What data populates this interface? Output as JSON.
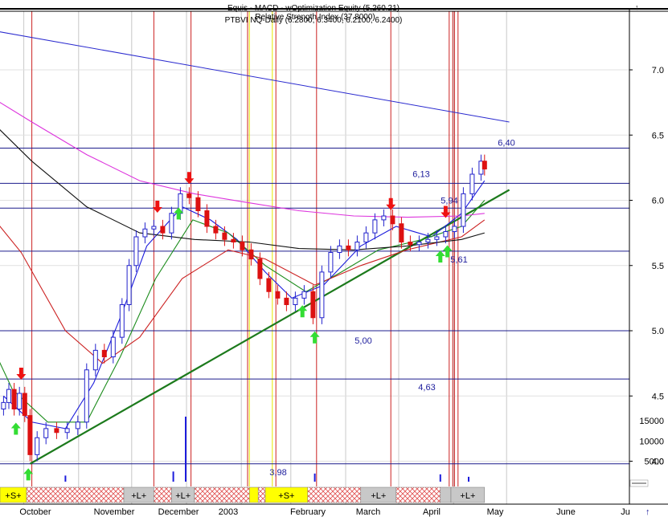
{
  "chart_data": {
    "type": "line",
    "subtype": "candlestick-price-chart",
    "header_lines": [
      "Equis - MACD - wOptimization Equity (5,260.21)",
      "Relative Strength Index (37.8000)",
      "PTBVI NQ-Daily (6.2800, 6.3400, 6.2100, 6.2400)"
    ],
    "x_ticks": [
      "October",
      "November",
      "December",
      "2003",
      "February",
      "March",
      "April",
      "May",
      "June",
      "Ju"
    ],
    "price_axis": {
      "ylim": [
        3.8,
        7.4
      ],
      "ticks": [
        "7.0",
        "6.5",
        "6.0",
        "5.5",
        "5.0",
        "4.5",
        "4.0"
      ]
    },
    "volume_axis": {
      "ylim": [
        0,
        17000
      ],
      "ticks": [
        "15000",
        "10000",
        "5000"
      ]
    },
    "horizontal_levels": [
      "6,40",
      "6,13",
      "5,94",
      "5,61",
      "5,00",
      "4,63",
      "3,98"
    ],
    "trend_lines": [
      {
        "name": "support",
        "color": "#1c7a1c",
        "from": {
          "date": "2002-09-30",
          "price": 3.98
        },
        "to": {
          "date": "2003-06-28",
          "price": 6.08
        }
      },
      {
        "name": "resistance",
        "color": "#2a2acf",
        "from": {
          "date": "2002-09-01",
          "price": 7.32
        },
        "to": {
          "date": "2003-06-28",
          "price": 6.6
        }
      }
    ],
    "buy_signals": [
      "2002-09-22",
      "2002-09-29",
      "2002-12-23",
      "2003-03-03",
      "2003-03-10",
      "2003-05-20",
      "2003-05-24"
    ],
    "sell_signals": [
      "2002-09-25",
      "2002-12-11",
      "2002-12-29",
      "2003-04-22",
      "2003-05-23"
    ],
    "signal_lines": [
      {
        "date": "2002-10-01",
        "color": "#cc2222"
      },
      {
        "date": "2002-12-09",
        "color": "#cc2222"
      },
      {
        "date": "2002-12-30",
        "color": "#cc2222"
      },
      {
        "date": "2003-01-31",
        "color": "#cc2222"
      },
      {
        "date": "2003-02-01",
        "color": "#e6e600"
      },
      {
        "date": "2003-02-14",
        "color": "#e6e600"
      },
      {
        "date": "2003-02-16",
        "color": "#cc2222"
      },
      {
        "date": "2003-03-11",
        "color": "#cc2222"
      },
      {
        "date": "2003-04-22",
        "color": "#cc2222"
      },
      {
        "date": "2003-05-25",
        "color": "#cc2222"
      },
      {
        "date": "2003-05-27",
        "color": "#cc2222"
      },
      {
        "date": "2003-05-28",
        "color": "#cc2222"
      },
      {
        "date": "2003-05-30",
        "color": "#cc2222"
      }
    ],
    "position_bands": [
      {
        "label": "+S+",
        "type": "short",
        "start": "2002-09-13",
        "end": "2002-09-28"
      },
      {
        "label": "",
        "type": "out",
        "start": "2002-09-28",
        "end": "2002-11-22"
      },
      {
        "label": "+L+",
        "type": "long",
        "start": "2002-11-22",
        "end": "2002-12-09"
      },
      {
        "label": "",
        "type": "out",
        "start": "2002-12-09",
        "end": "2002-12-19"
      },
      {
        "label": "+L+",
        "type": "long",
        "start": "2002-12-19",
        "end": "2003-01-01"
      },
      {
        "label": "",
        "type": "out",
        "start": "2003-01-01",
        "end": "2003-02-01"
      },
      {
        "label": "",
        "type": "yellow",
        "start": "2003-02-01",
        "end": "2003-02-06"
      },
      {
        "label": "",
        "type": "out",
        "start": "2003-02-06",
        "end": "2003-02-10"
      },
      {
        "label": "+S+",
        "type": "short",
        "start": "2003-02-10",
        "end": "2003-03-06"
      },
      {
        "label": "",
        "type": "out",
        "start": "2003-03-06",
        "end": "2003-04-05"
      },
      {
        "label": "+L+",
        "type": "long",
        "start": "2003-04-05",
        "end": "2003-04-25"
      },
      {
        "label": "",
        "type": "out",
        "start": "2003-04-25",
        "end": "2003-05-20"
      },
      {
        "label": "",
        "type": "long",
        "start": "2003-05-20",
        "end": "2003-05-26"
      },
      {
        "label": "+L+",
        "type": "long",
        "start": "2003-05-26",
        "end": "2003-06-14"
      }
    ],
    "series": [
      {
        "name": "",
        "kind": "candles",
        "colors": {
          "up": "#2222cc",
          "down": "#dd1111"
        },
        "points": [
          {
            "date": "2002-09-15",
            "close": 4.45
          },
          {
            "date": "2002-09-18",
            "close": 4.55
          },
          {
            "date": "2002-09-21",
            "close": 4.4
          },
          {
            "date": "2002-09-24",
            "close": 4.52
          },
          {
            "date": "2002-09-27",
            "close": 4.35
          },
          {
            "date": "2002-09-30",
            "close": 4.05
          },
          {
            "date": "2002-10-04",
            "close": 4.18
          },
          {
            "date": "2002-10-09",
            "close": 4.25
          },
          {
            "date": "2002-10-15",
            "close": 4.22
          },
          {
            "date": "2002-10-21",
            "close": 4.25
          },
          {
            "date": "2002-10-27",
            "close": 4.3
          },
          {
            "date": "2002-11-01",
            "close": 4.7
          },
          {
            "date": "2002-11-06",
            "close": 4.85
          },
          {
            "date": "2002-11-11",
            "close": 4.8
          },
          {
            "date": "2002-11-16",
            "close": 4.95
          },
          {
            "date": "2002-11-21",
            "close": 5.2
          },
          {
            "date": "2002-11-25",
            "close": 5.5
          },
          {
            "date": "2002-11-29",
            "close": 5.72
          },
          {
            "date": "2002-12-04",
            "close": 5.78
          },
          {
            "date": "2002-12-09",
            "close": 5.8
          },
          {
            "date": "2002-12-14",
            "close": 5.75
          },
          {
            "date": "2002-12-19",
            "close": 5.9
          },
          {
            "date": "2002-12-24",
            "close": 6.05
          },
          {
            "date": "2002-12-29",
            "close": 6.02
          },
          {
            "date": "2003-01-03",
            "close": 5.92
          },
          {
            "date": "2003-01-08",
            "close": 5.8
          },
          {
            "date": "2003-01-13",
            "close": 5.75
          },
          {
            "date": "2003-01-18",
            "close": 5.7
          },
          {
            "date": "2003-01-23",
            "close": 5.68
          },
          {
            "date": "2003-01-28",
            "close": 5.62
          },
          {
            "date": "2003-02-02",
            "close": 5.55
          },
          {
            "date": "2003-02-07",
            "close": 5.4
          },
          {
            "date": "2003-02-12",
            "close": 5.3
          },
          {
            "date": "2003-02-17",
            "close": 5.25
          },
          {
            "date": "2003-02-22",
            "close": 5.2
          },
          {
            "date": "2003-02-27",
            "close": 5.25
          },
          {
            "date": "2003-03-04",
            "close": 5.3
          },
          {
            "date": "2003-03-09",
            "close": 5.1
          },
          {
            "date": "2003-03-14",
            "close": 5.45
          },
          {
            "date": "2003-03-19",
            "close": 5.6
          },
          {
            "date": "2003-03-24",
            "close": 5.65
          },
          {
            "date": "2003-03-29",
            "close": 5.62
          },
          {
            "date": "2003-04-03",
            "close": 5.68
          },
          {
            "date": "2003-04-08",
            "close": 5.75
          },
          {
            "date": "2003-04-13",
            "close": 5.85
          },
          {
            "date": "2003-04-18",
            "close": 5.88
          },
          {
            "date": "2003-04-23",
            "close": 5.82
          },
          {
            "date": "2003-04-28",
            "close": 5.68
          },
          {
            "date": "2003-05-03",
            "close": 5.66
          },
          {
            "date": "2003-05-08",
            "close": 5.68
          },
          {
            "date": "2003-05-13",
            "close": 5.7
          },
          {
            "date": "2003-05-18",
            "close": 5.72
          },
          {
            "date": "2003-05-23",
            "close": 5.76
          },
          {
            "date": "2003-05-28",
            "close": 5.8
          },
          {
            "date": "2003-06-02",
            "close": 6.05
          },
          {
            "date": "2003-06-07",
            "close": 6.2
          },
          {
            "date": "2003-06-12",
            "close": 6.3
          },
          {
            "date": "2003-06-14",
            "close": 6.24
          }
        ]
      },
      {
        "name": "",
        "kind": "moving-average",
        "color": "#1c1cdc",
        "points": [
          {
            "date": "2002-09-15",
            "value": 4.5
          },
          {
            "date": "2002-10-01",
            "value": 4.3
          },
          {
            "date": "2002-10-20",
            "value": 4.25
          },
          {
            "date": "2002-11-05",
            "value": 4.6
          },
          {
            "date": "2002-11-20",
            "value": 5.1
          },
          {
            "date": "2002-12-05",
            "value": 5.65
          },
          {
            "date": "2002-12-25",
            "value": 5.95
          },
          {
            "date": "2003-01-10",
            "value": 5.85
          },
          {
            "date": "2003-01-25",
            "value": 5.7
          },
          {
            "date": "2003-02-10",
            "value": 5.45
          },
          {
            "date": "2003-02-25",
            "value": 5.25
          },
          {
            "date": "2003-03-15",
            "value": 5.35
          },
          {
            "date": "2003-04-05",
            "value": 5.65
          },
          {
            "date": "2003-04-25",
            "value": 5.8
          },
          {
            "date": "2003-05-15",
            "value": 5.72
          },
          {
            "date": "2003-06-01",
            "value": 5.9
          },
          {
            "date": "2003-06-14",
            "value": 6.15
          }
        ]
      },
      {
        "name": "",
        "kind": "moving-average",
        "color": "#1c8c1c",
        "points": [
          {
            "date": "2002-09-01",
            "value": 5.1
          },
          {
            "date": "2002-09-20",
            "value": 4.55
          },
          {
            "date": "2002-10-10",
            "value": 4.3
          },
          {
            "date": "2002-11-01",
            "value": 4.3
          },
          {
            "date": "2002-11-20",
            "value": 4.8
          },
          {
            "date": "2002-12-10",
            "value": 5.4
          },
          {
            "date": "2002-12-31",
            "value": 5.85
          },
          {
            "date": "2003-01-20",
            "value": 5.75
          },
          {
            "date": "2003-02-10",
            "value": 5.5
          },
          {
            "date": "2003-03-05",
            "value": 5.3
          },
          {
            "date": "2003-03-25",
            "value": 5.45
          },
          {
            "date": "2003-04-15",
            "value": 5.62
          },
          {
            "date": "2003-05-10",
            "value": 5.7
          },
          {
            "date": "2003-06-01",
            "value": 5.8
          },
          {
            "date": "2003-06-14",
            "value": 6.0
          }
        ]
      },
      {
        "name": "",
        "kind": "moving-average",
        "color": "#cc2222",
        "points": [
          {
            "date": "2002-09-01",
            "value": 6.0
          },
          {
            "date": "2002-09-25",
            "value": 5.6
          },
          {
            "date": "2002-10-20",
            "value": 5.0
          },
          {
            "date": "2002-11-10",
            "value": 4.75
          },
          {
            "date": "2002-12-01",
            "value": 4.95
          },
          {
            "date": "2002-12-25",
            "value": 5.4
          },
          {
            "date": "2003-01-20",
            "value": 5.62
          },
          {
            "date": "2003-02-10",
            "value": 5.55
          },
          {
            "date": "2003-03-10",
            "value": 5.35
          },
          {
            "date": "2003-04-05",
            "value": 5.5
          },
          {
            "date": "2003-05-01",
            "value": 5.62
          },
          {
            "date": "2003-06-01",
            "value": 5.72
          },
          {
            "date": "2003-06-14",
            "value": 5.85
          }
        ]
      },
      {
        "name": "",
        "kind": "moving-average",
        "color": "#dd33dd",
        "points": [
          {
            "date": "2002-09-01",
            "value": 6.85
          },
          {
            "date": "2002-10-01",
            "value": 6.6
          },
          {
            "date": "2002-11-01",
            "value": 6.35
          },
          {
            "date": "2002-12-01",
            "value": 6.15
          },
          {
            "date": "2003-01-01",
            "value": 6.05
          },
          {
            "date": "2003-02-01",
            "value": 5.98
          },
          {
            "date": "2003-03-01",
            "value": 5.92
          },
          {
            "date": "2003-04-01",
            "value": 5.88
          },
          {
            "date": "2003-05-01",
            "value": 5.87
          },
          {
            "date": "2003-06-01",
            "value": 5.88
          },
          {
            "date": "2003-06-14",
            "value": 5.9
          }
        ]
      },
      {
        "name": "",
        "kind": "moving-average",
        "color": "#111111",
        "points": [
          {
            "date": "2002-09-01",
            "value": 6.7
          },
          {
            "date": "2002-10-01",
            "value": 6.3
          },
          {
            "date": "2002-11-01",
            "value": 5.95
          },
          {
            "date": "2002-12-01",
            "value": 5.75
          },
          {
            "date": "2003-01-01",
            "value": 5.7
          },
          {
            "date": "2003-02-01",
            "value": 5.68
          },
          {
            "date": "2003-03-01",
            "value": 5.63
          },
          {
            "date": "2003-04-01",
            "value": 5.62
          },
          {
            "date": "2003-05-01",
            "value": 5.65
          },
          {
            "date": "2003-06-01",
            "value": 5.7
          },
          {
            "date": "2003-06-14",
            "value": 5.75
          }
        ]
      },
      {
        "name": "",
        "kind": "volume",
        "color": "#1c1cdc",
        "points": [
          {
            "date": "2002-12-27",
            "value": 16000
          },
          {
            "date": "2002-10-20",
            "value": 1500
          },
          {
            "date": "2002-12-20",
            "value": 2500
          },
          {
            "date": "2003-03-10",
            "value": 2000
          },
          {
            "date": "2003-05-20",
            "value": 1800
          },
          {
            "date": "2003-06-05",
            "value": 1200
          }
        ]
      }
    ],
    "grid": true,
    "legend": "none"
  }
}
